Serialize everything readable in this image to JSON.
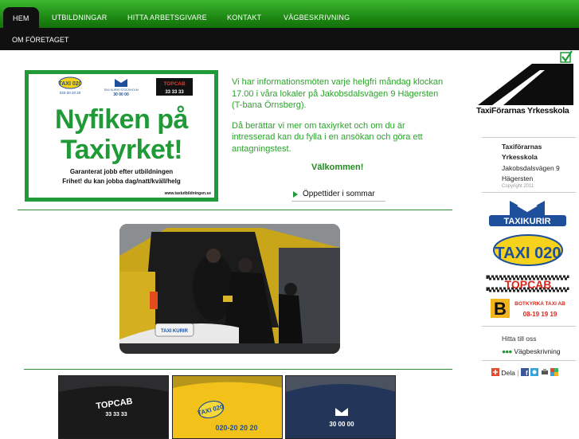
{
  "nav": {
    "items": [
      {
        "label": "HEM",
        "active": true
      },
      {
        "label": "UTBILDNINGAR",
        "active": false
      },
      {
        "label": "HITTA ARBETSGIVARE",
        "active": false
      },
      {
        "label": "KONTAKT",
        "active": false
      },
      {
        "label": "VÄGBESKRIVNING",
        "active": false
      }
    ],
    "subitem": "OM FÖRETAGET"
  },
  "ad": {
    "logos": [
      "TAXI 020",
      "TAXI KURIR STOCKHOLM",
      "TOPCAB"
    ],
    "logo_phones": [
      "020-20 20 20",
      "30 00 00",
      "33 33 33"
    ],
    "headline_1": "Nyfiken på",
    "headline_2": "Taxiyrket!",
    "line_1": "Garanterat jobb efter utbildningen",
    "line_2": "Frihet! du kan jobba dag/natt/kväll/helg",
    "url": "www.taxiutbildningen.se"
  },
  "info": {
    "paragraph_1": "Vi har informationsmöten varje helgfri måndag klockan 17.00 i våra lokaler på Jakobsdalsvägen 9 Hägersten (T-bana Örnsberg).",
    "paragraph_2": "Då berättar vi mer om taxiyrket och om du är intresserad kan du fylla i en ansökan och göra ett antagningstest.",
    "welcome": "Välkommen!",
    "hours_link": "Öppettider i sommar"
  },
  "sidebar": {
    "logo_text": "TaxiFörarnas Yrkesskola",
    "address_name_1": "Taxiförarnas",
    "address_name_2": "Yrkesskola",
    "address_street": "Jakobsdalsvägen 9",
    "address_city": "Hägersten",
    "copyright": "Copyright 2011",
    "partners": [
      "TAXIKURIR",
      "TAXI 020",
      "TOPCAB",
      "BOTKYRKA TAXI AB"
    ],
    "botkyrka_phone": "08-19 19 19",
    "find_us": "Hitta till oss",
    "route": "Vägbeskrivning",
    "share": "Dela"
  },
  "photo": {
    "taxi_sign": "TAXI KURIR",
    "plate": "30 00 00"
  },
  "colors": {
    "brand_green": "#1f9a36",
    "nav_green": "#2aa11f",
    "nav_dark": "#101010"
  }
}
